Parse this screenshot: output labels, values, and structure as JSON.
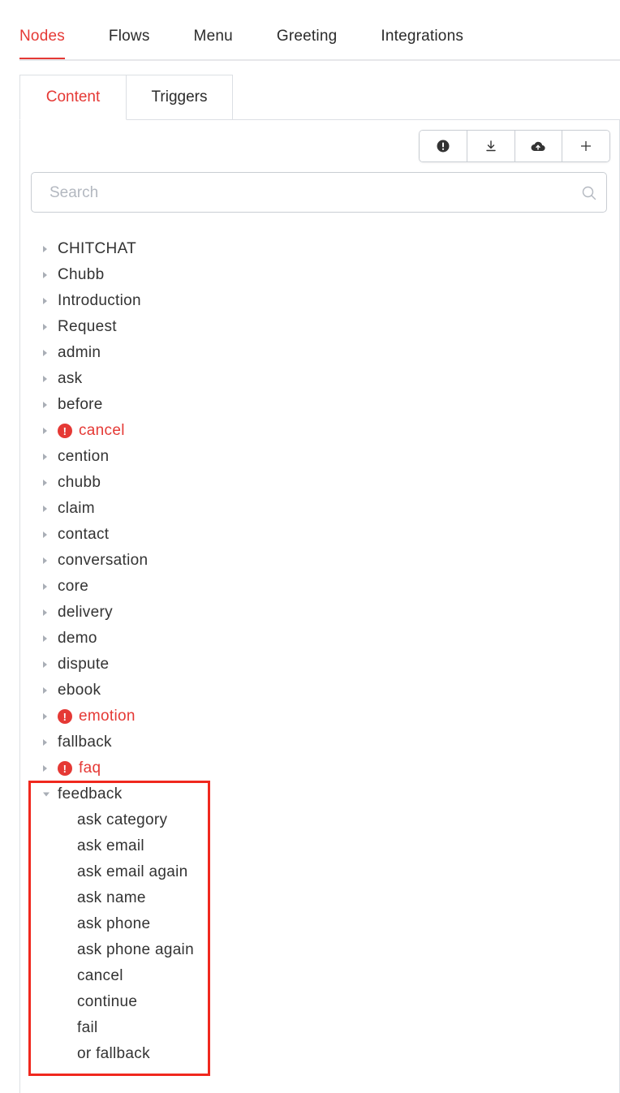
{
  "top_tabs": [
    "Nodes",
    "Flows",
    "Menu",
    "Greeting",
    "Integrations"
  ],
  "sub_tabs": [
    "Content",
    "Triggers"
  ],
  "toolbar": {
    "icons": [
      "exclamation-circle-icon",
      "download-icon",
      "cloud-upload-icon",
      "plus-icon"
    ]
  },
  "search": {
    "placeholder": "Search",
    "value": ""
  },
  "tree": {
    "nodes": [
      {
        "label": "CHITCHAT",
        "error": false
      },
      {
        "label": "Chubb",
        "error": false
      },
      {
        "label": "Introduction",
        "error": false
      },
      {
        "label": "Request",
        "error": false
      },
      {
        "label": "admin",
        "error": false
      },
      {
        "label": "ask",
        "error": false
      },
      {
        "label": "before",
        "error": false
      },
      {
        "label": "cancel",
        "error": true
      },
      {
        "label": "cention",
        "error": false
      },
      {
        "label": "chubb",
        "error": false
      },
      {
        "label": "claim",
        "error": false
      },
      {
        "label": "contact",
        "error": false
      },
      {
        "label": "conversation",
        "error": false
      },
      {
        "label": "core",
        "error": false
      },
      {
        "label": "delivery",
        "error": false
      },
      {
        "label": "demo",
        "error": false
      },
      {
        "label": "dispute",
        "error": false
      },
      {
        "label": "ebook",
        "error": false
      },
      {
        "label": "emotion",
        "error": true
      },
      {
        "label": "fallback",
        "error": false
      },
      {
        "label": "faq",
        "error": true
      }
    ],
    "expanded_node": {
      "label": "feedback",
      "children": [
        "ask category",
        "ask email",
        "ask email again",
        "ask name",
        "ask phone",
        "ask phone again",
        "cancel",
        "continue",
        "fail",
        "or fallback"
      ]
    }
  },
  "colors": {
    "accent": "#e53935",
    "highlight_box": "#f0281e",
    "border": "#dcdfe4"
  }
}
